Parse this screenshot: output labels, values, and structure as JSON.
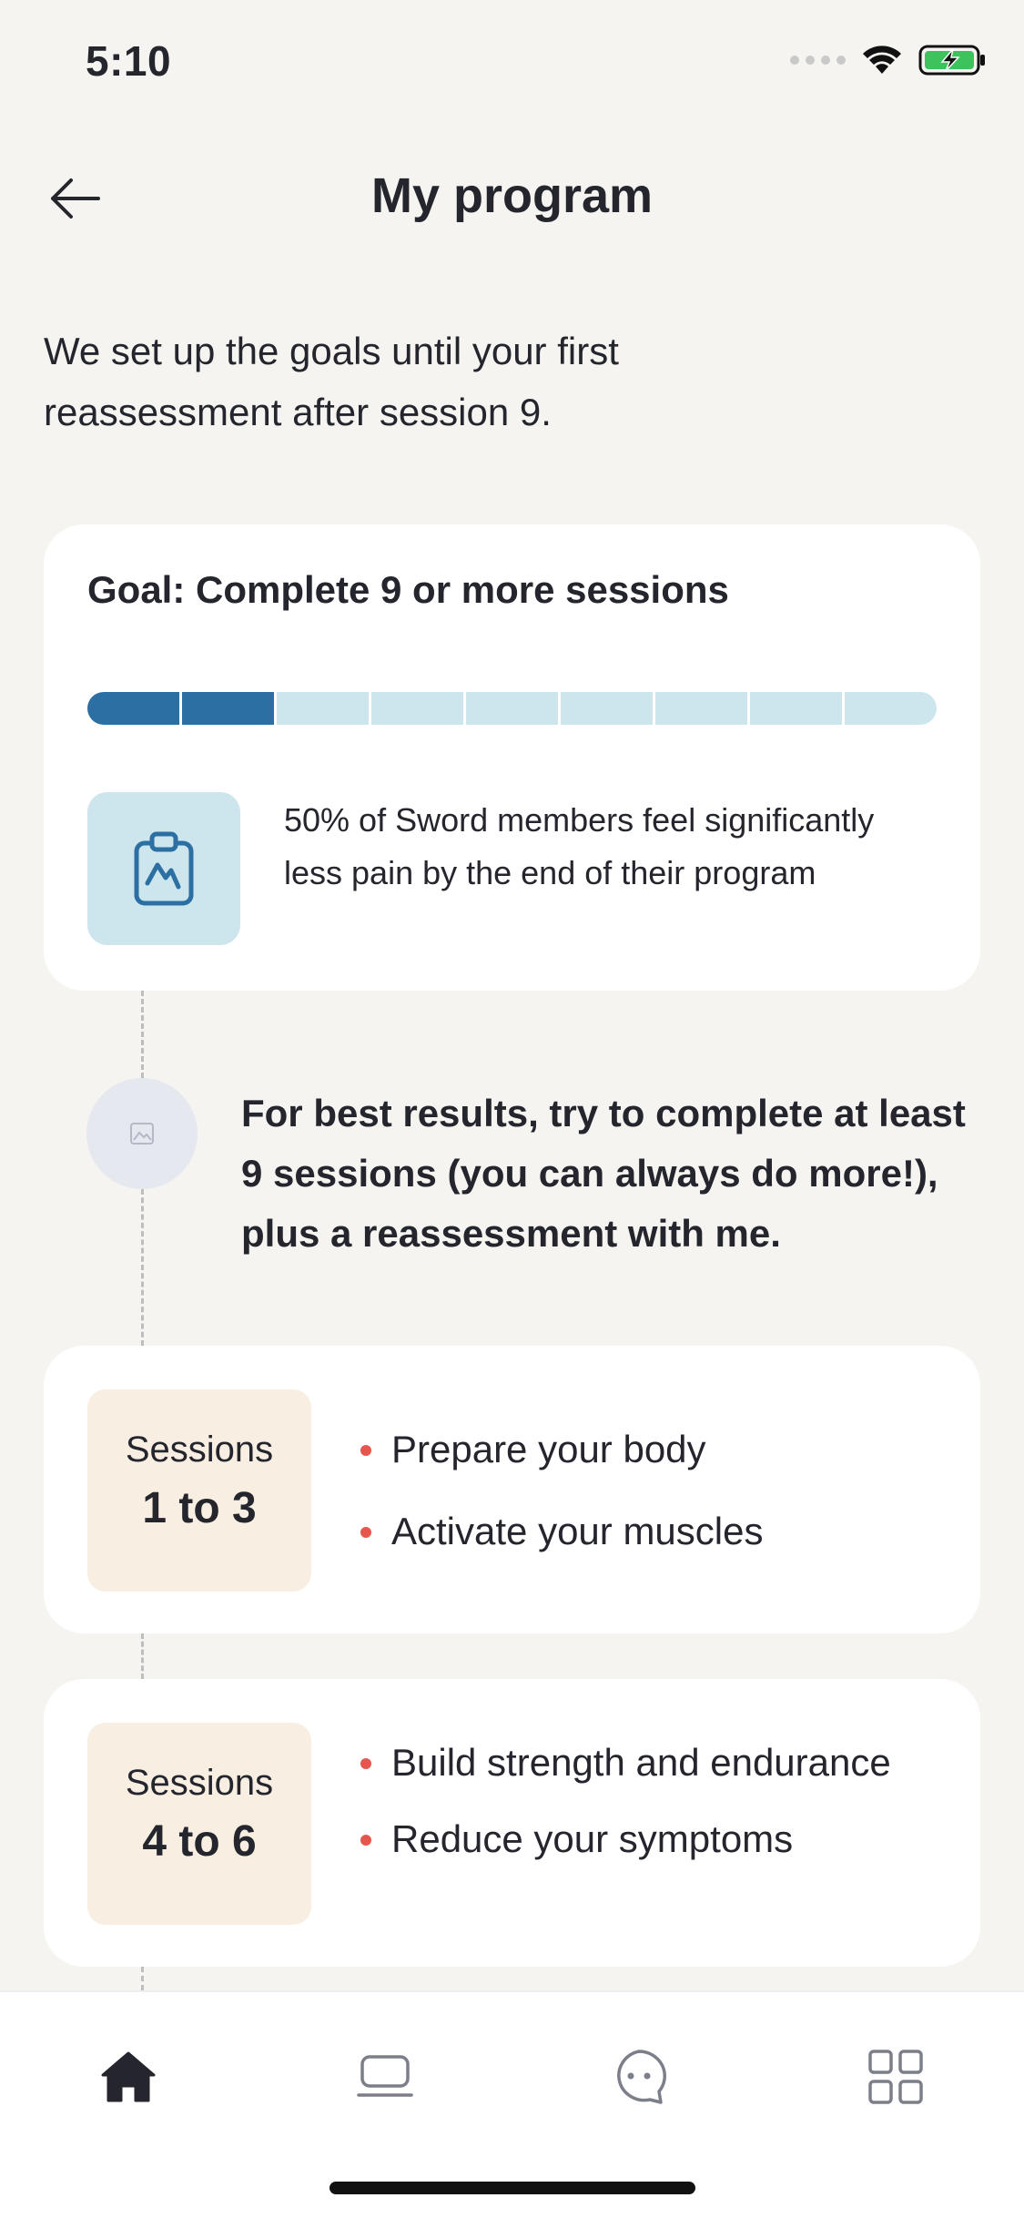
{
  "status_bar": {
    "time": "5:10"
  },
  "header": {
    "title": "My program"
  },
  "intro": "We set up the goals until your first reassessment after session 9.",
  "goal_card": {
    "title": "Goal: Complete 9 or more sessions",
    "progress": {
      "completed": 2,
      "total": 9
    },
    "tip": "50% of Sword members feel significantly less pain by the end of their program",
    "tip_icon": "clipboard-chart-icon"
  },
  "coach": {
    "message": "For best results, try to complete at least 9 sessions (you can always do more!), plus a reassessment with me."
  },
  "phases": [
    {
      "label": "Sessions",
      "range": "1 to 3",
      "items": [
        "Prepare your body",
        "Activate your muscles"
      ]
    },
    {
      "label": "Sessions",
      "range": "4 to 6",
      "items": [
        "Build strength and endurance",
        "Reduce your symptoms"
      ]
    }
  ],
  "tab_bar": [
    {
      "name": "home",
      "icon": "home-icon",
      "active": true
    },
    {
      "name": "sessions",
      "icon": "laptop-icon",
      "active": false
    },
    {
      "name": "chat",
      "icon": "chat-icon",
      "active": false
    },
    {
      "name": "menu",
      "icon": "grid-icon",
      "active": false
    }
  ],
  "colors": {
    "background": "#f6f4f1",
    "card": "#ffffff",
    "progress_done": "#2b6fa3",
    "progress_todo": "#cde5ec",
    "badge": "#f8efe2",
    "bullet": "#e5564f",
    "text": "#24252d"
  }
}
